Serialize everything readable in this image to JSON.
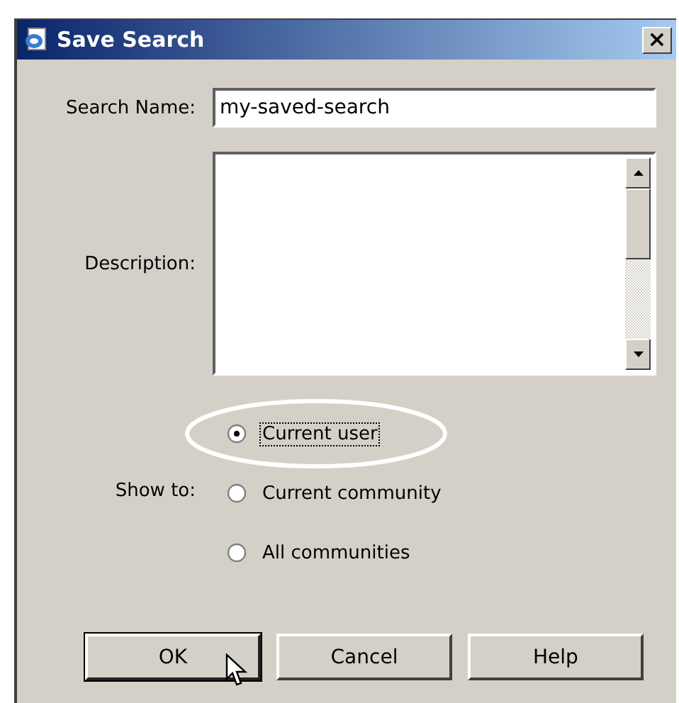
{
  "window": {
    "title": "Save Search",
    "close": "×"
  },
  "search_name": {
    "label": "Search Name:",
    "value": "my-saved-search"
  },
  "description": {
    "label": "Description:"
  },
  "show_to": {
    "label": "Show to:",
    "options": [
      {
        "label": "Current user",
        "selected": true,
        "focused": true,
        "highlighted": true
      },
      {
        "label": "Current community",
        "selected": false,
        "focused": false,
        "highlighted": false
      },
      {
        "label": "All communities",
        "selected": false,
        "focused": false,
        "highlighted": false
      }
    ]
  },
  "buttons": [
    {
      "label": "OK",
      "hovered": true
    },
    {
      "label": "Cancel",
      "hovered": false
    },
    {
      "label": "Help",
      "hovered": false
    }
  ]
}
